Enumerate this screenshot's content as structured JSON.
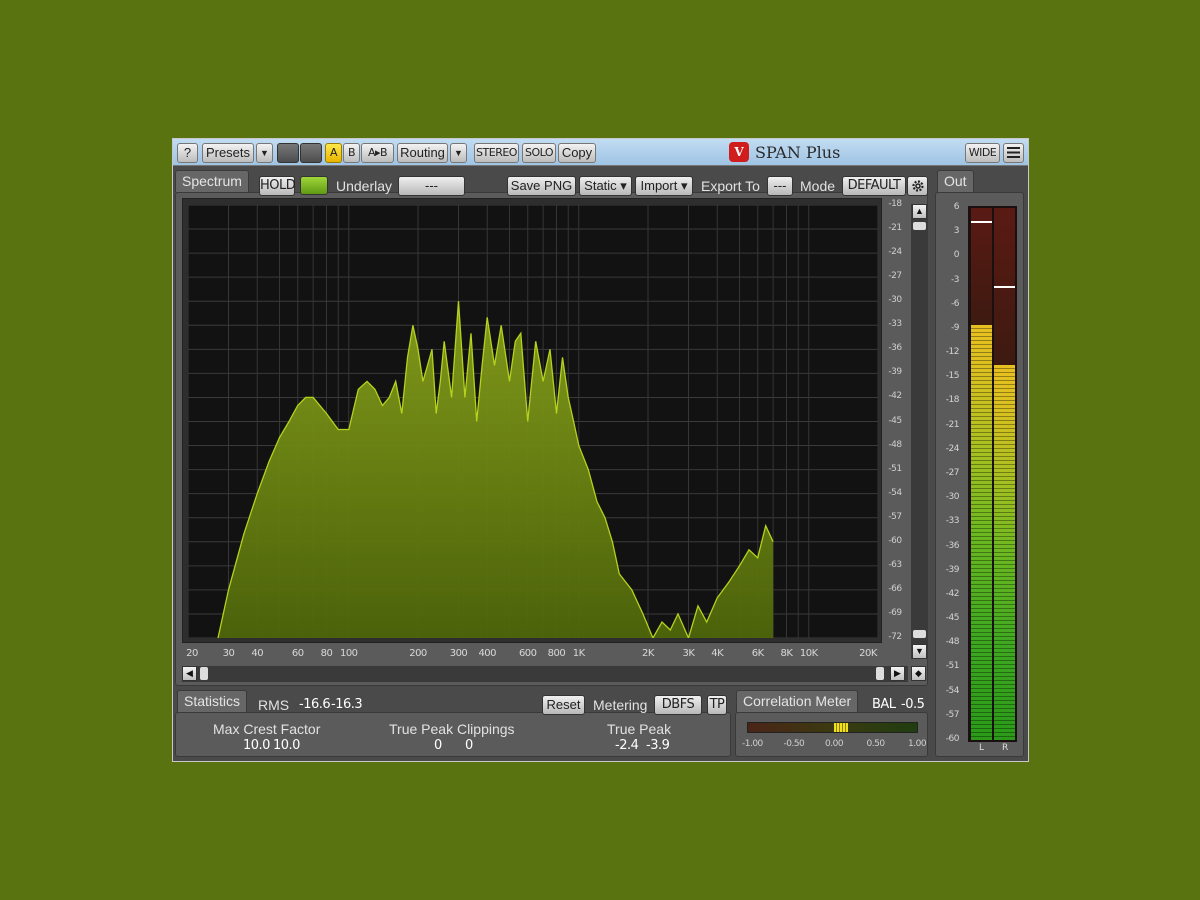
{
  "toolbar": {
    "help": "?",
    "presets": "Presets",
    "dropdown": "▼",
    "ab_a": "A",
    "ab_b": "B",
    "ab_copy": "A▸B",
    "routing": "Routing",
    "stereo": "STEREO",
    "solo": "SOLO",
    "copy": "Copy",
    "logo": "V",
    "title": "SPAN Plus",
    "wide": "WIDE",
    "menu_icon": "hamburger-icon"
  },
  "spectrum": {
    "tab": "Spectrum",
    "hold": "HOLD",
    "underlay_label": "Underlay",
    "underlay_value": "---",
    "save_png": "Save PNG",
    "static": "Static ▾",
    "import": "Import ▾",
    "export_label": "Export To",
    "export_value": "---",
    "mode_label": "Mode",
    "mode_value": "DEFAULT",
    "settings_icon": "gear-icon",
    "fill_color": "#7a8f10",
    "line_color": "#b4d21e",
    "y_ticks": [
      "-18",
      "-21",
      "-24",
      "-27",
      "-30",
      "-33",
      "-36",
      "-39",
      "-42",
      "-45",
      "-48",
      "-51",
      "-54",
      "-57",
      "-60",
      "-63",
      "-66",
      "-69",
      "-72"
    ],
    "x_ticks": [
      "20",
      "30",
      "40",
      "60",
      "80",
      "100",
      "200",
      "300",
      "400",
      "600",
      "800",
      "1K",
      "2K",
      "3K",
      "4K",
      "6K",
      "8K",
      "10K",
      "20K"
    ]
  },
  "chart_data": {
    "type": "area",
    "x_scale": "log",
    "xlim": [
      20,
      20000
    ],
    "ylim": [
      -72,
      -18
    ],
    "x": [
      27,
      30,
      35,
      40,
      45,
      50,
      55,
      60,
      65,
      70,
      80,
      90,
      100,
      110,
      120,
      130,
      140,
      150,
      160,
      170,
      180,
      190,
      200,
      210,
      220,
      230,
      240,
      250,
      260,
      280,
      300,
      320,
      340,
      360,
      380,
      400,
      430,
      460,
      500,
      530,
      560,
      600,
      650,
      700,
      750,
      800,
      850,
      900,
      950,
      1000,
      1100,
      1200,
      1300,
      1400,
      1500,
      1700,
      1900,
      2100,
      2300,
      2500,
      2700,
      3000,
      3300,
      3600,
      4000,
      4500,
      5000,
      5500,
      6000,
      6500,
      7000,
      7500,
      8000,
      8500,
      9000,
      9500,
      10000,
      10500,
      11000,
      12000,
      13000,
      14000,
      15000
    ],
    "y": [
      -72,
      -66,
      -59,
      -54,
      -50,
      -47,
      -45,
      -43,
      -42,
      -42,
      -44,
      -46,
      -46,
      -41,
      -40,
      -41,
      -43,
      -42,
      -40,
      -44,
      -37,
      -33,
      -36,
      -40,
      -38,
      -36,
      -44,
      -40,
      -35,
      -42,
      -30,
      -42,
      -34,
      -45,
      -38,
      -32,
      -38,
      -33,
      -40,
      -35,
      -34,
      -45,
      -35,
      -40,
      -36,
      -44,
      -37,
      -42,
      -45,
      -48,
      -51,
      -55,
      -57,
      -60,
      -64,
      -66,
      -69,
      -72,
      -70,
      -71,
      -69,
      -72,
      -68,
      -70,
      -67,
      -65,
      -63,
      -61,
      -62,
      -58,
      -60
    ],
    "y_unit": "dB"
  },
  "statistics": {
    "tab": "Statistics",
    "rms_label": "RMS",
    "rms_l": "-16.6",
    "rms_r": "-16.3",
    "reset": "Reset",
    "metering_label": "Metering",
    "metering_value": "DBFS",
    "tp": "TP",
    "crest_label": "Max Crest Factor",
    "crest_l": "10.0",
    "crest_r": "10.0",
    "clip_label": "True Peak Clippings",
    "clip_l": "0",
    "clip_r": "0",
    "tpeak_label": "True Peak",
    "tpeak_l": "-2.4",
    "tpeak_r": "-3.9"
  },
  "correlation": {
    "tab": "Correlation Meter",
    "bal_label": "BAL",
    "bal_value": "-0.5",
    "ticks": [
      "-1.00",
      "-0.50",
      "0.00",
      "0.50",
      "1.00"
    ],
    "value": 0.05
  },
  "output": {
    "tab": "Out",
    "ticks": [
      "6",
      "3",
      "0",
      "-3",
      "-6",
      "-9",
      "-12",
      "-15",
      "-18",
      "-21",
      "-24",
      "-27",
      "-30",
      "-33",
      "-36",
      "-39",
      "-42",
      "-45",
      "-48",
      "-51",
      "-54",
      "-57",
      "-60"
    ],
    "l_label": "L",
    "r_label": "R",
    "l_level": -8.5,
    "r_level": -13.5,
    "l_peak": 4.4,
    "r_peak": -3.7
  }
}
